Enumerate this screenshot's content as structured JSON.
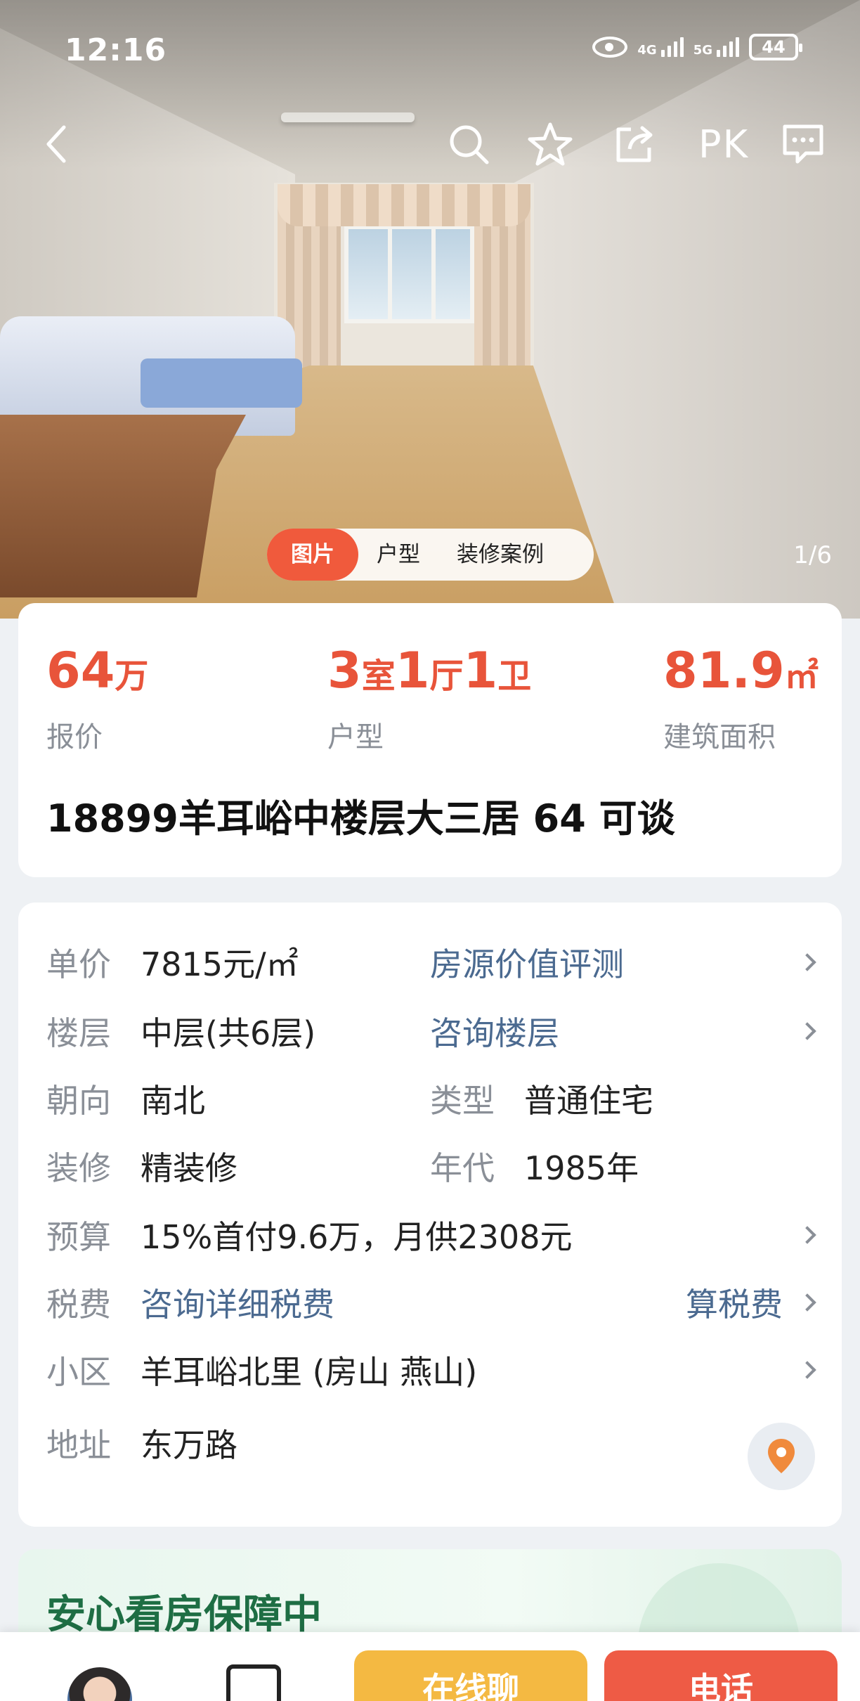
{
  "status_bar": {
    "time": "12:16",
    "net1": "4G",
    "net2": "5G",
    "battery": "44"
  },
  "nav": {
    "pk_label": "PK"
  },
  "gallery": {
    "tabs": [
      "图片",
      "户型",
      "装修案例"
    ],
    "active_tab": "图片",
    "counter": "1/6"
  },
  "summary": {
    "price_value": "64",
    "price_unit": "万",
    "price_label": "报价",
    "layout_rooms": "3",
    "layout_rooms_unit": "室",
    "layout_halls": "1",
    "layout_halls_unit": "厅",
    "layout_baths": "1",
    "layout_baths_unit": "卫",
    "layout_label": "户型",
    "area_value": "81.9",
    "area_unit": "㎡",
    "area_label": "建筑面积",
    "title": "18899羊耳峪中楼层大三居 64 可谈"
  },
  "details": {
    "unit_price_key": "单价",
    "unit_price": "7815元/㎡",
    "valuation_link": "房源价值评测",
    "floor_key": "楼层",
    "floor": "中层(共6层)",
    "floor_link": "咨询楼层",
    "orientation_key": "朝向",
    "orientation": "南北",
    "type_key": "类型",
    "type": "普通住宅",
    "decoration_key": "装修",
    "decoration": "精装修",
    "year_key": "年代",
    "year": "1985年",
    "budget_key": "预算",
    "budget": "15%首付9.6万，月供2308元",
    "tax_key": "税费",
    "tax_link": "咨询详细税费",
    "tax_calc": "算税费",
    "community_key": "小区",
    "community": "羊耳峪北里 (房山 燕山)",
    "address_key": "地址",
    "address": "东万路"
  },
  "guarantee": {
    "title": "安心看房保障中"
  },
  "bottom_bar": {
    "online_label": "在线聊",
    "call_label": "电话"
  },
  "colors": {
    "accent": "#e8543a",
    "link": "#4b6a90",
    "muted": "#8a8f97",
    "online": "#f4b942",
    "call": "#ee5b45"
  }
}
